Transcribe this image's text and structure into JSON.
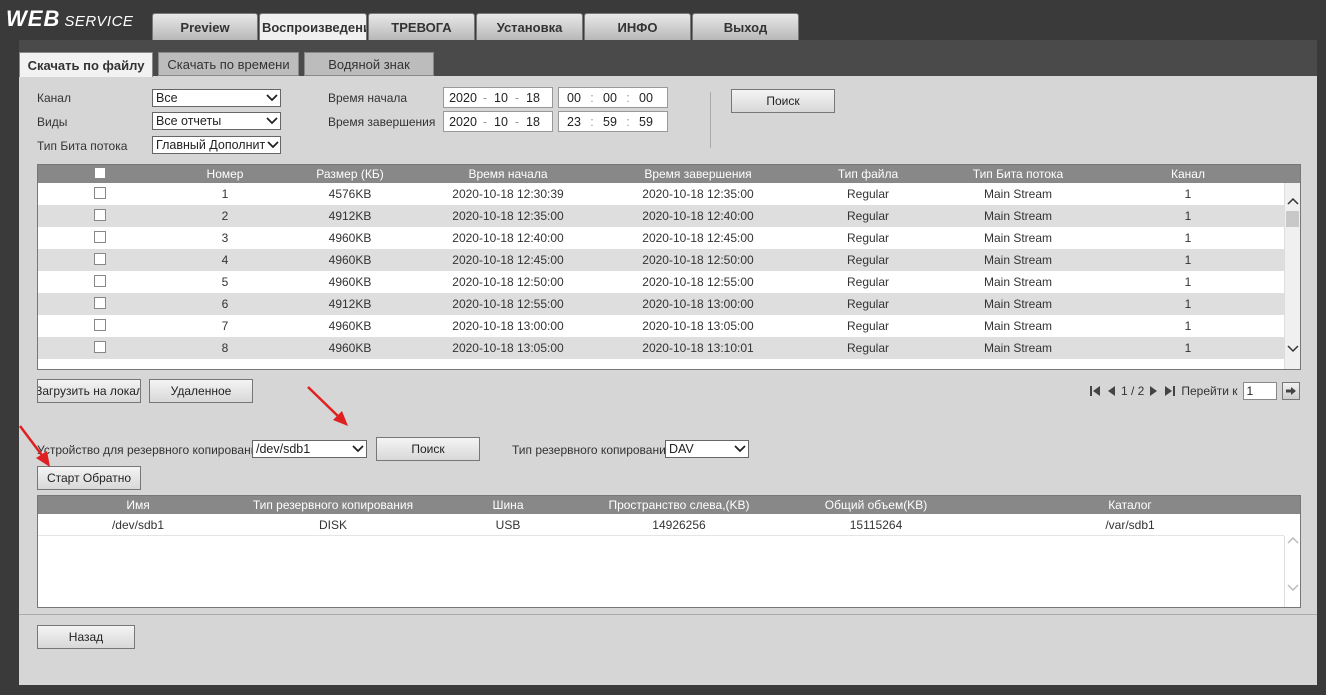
{
  "header": {
    "logo_bold": "WEB",
    "logo_rest": "SERVICE",
    "tabs": [
      {
        "label": "Preview"
      },
      {
        "label": "Воспроизведени"
      },
      {
        "label": "ТРЕВОГА"
      },
      {
        "label": "Установка"
      },
      {
        "label": "ИНФО"
      },
      {
        "label": "Выход"
      }
    ]
  },
  "subtabs": [
    "Скачать по файлу",
    "Скачать по времени",
    "Водяной знак"
  ],
  "filters": {
    "channel_label": "Канал",
    "channel_value": "Все",
    "types_label": "Виды",
    "types_value": "Все отчеты",
    "bitstream_label": "Тип Бита потока",
    "bitstream_value": "Главный Дополнит",
    "start_label": "Время начала",
    "start_date": [
      "2020",
      "10",
      "18"
    ],
    "start_time": [
      "00",
      "00",
      "00"
    ],
    "end_label": "Время завершения",
    "end_date": [
      "2020",
      "10",
      "18"
    ],
    "end_time": [
      "23",
      "59",
      "59"
    ],
    "search_button": "Поиск"
  },
  "files_table": {
    "columns": [
      "Номер",
      "Размер (КБ)",
      "Время начала",
      "Время завершения",
      "Тип файла",
      "Тип Бита потока",
      "Канал"
    ],
    "rows": [
      [
        "1",
        "4576KB",
        "2020-10-18 12:30:39",
        "2020-10-18 12:35:00",
        "Regular",
        "Main Stream",
        "1"
      ],
      [
        "2",
        "4912KB",
        "2020-10-18 12:35:00",
        "2020-10-18 12:40:00",
        "Regular",
        "Main Stream",
        "1"
      ],
      [
        "3",
        "4960KB",
        "2020-10-18 12:40:00",
        "2020-10-18 12:45:00",
        "Regular",
        "Main Stream",
        "1"
      ],
      [
        "4",
        "4960KB",
        "2020-10-18 12:45:00",
        "2020-10-18 12:50:00",
        "Regular",
        "Main Stream",
        "1"
      ],
      [
        "5",
        "4960KB",
        "2020-10-18 12:50:00",
        "2020-10-18 12:55:00",
        "Regular",
        "Main Stream",
        "1"
      ],
      [
        "6",
        "4912KB",
        "2020-10-18 12:55:00",
        "2020-10-18 13:00:00",
        "Regular",
        "Main Stream",
        "1"
      ],
      [
        "7",
        "4960KB",
        "2020-10-18 13:00:00",
        "2020-10-18 13:05:00",
        "Regular",
        "Main Stream",
        "1"
      ],
      [
        "8",
        "4960KB",
        "2020-10-18 13:05:00",
        "2020-10-18 13:10:01",
        "Regular",
        "Main Stream",
        "1"
      ]
    ]
  },
  "actions": {
    "download_local": "Загрузить на локал",
    "remote": "Удаленное"
  },
  "pagination": {
    "page_text": "1 / 2",
    "goto_label": "Перейти к",
    "goto_value": "1"
  },
  "backup": {
    "device_label": "Устройство для резервного копирования",
    "device_value": "/dev/sdb1",
    "search_button": "Поиск",
    "type_label": "Тип резервного копирования",
    "type_value": "DAV",
    "start_button": "Старт Обратно"
  },
  "device_table": {
    "columns": [
      "Имя",
      "Тип резервного копирования",
      "Шина",
      "Пространство слева,(KB)",
      "Общий объем(KB)",
      "Каталог"
    ],
    "rows": [
      [
        "/dev/sdb1",
        "DISK",
        "USB",
        "14926256",
        "15115264",
        "/var/sdb1"
      ]
    ]
  },
  "footer": {
    "back_button": "Назад"
  },
  "colors": {
    "annotation_arrow": "#e02020",
    "header_bg": "#3a3a3a",
    "panel_bg": "#d6d6d6",
    "table_header_bg": "#888888"
  }
}
